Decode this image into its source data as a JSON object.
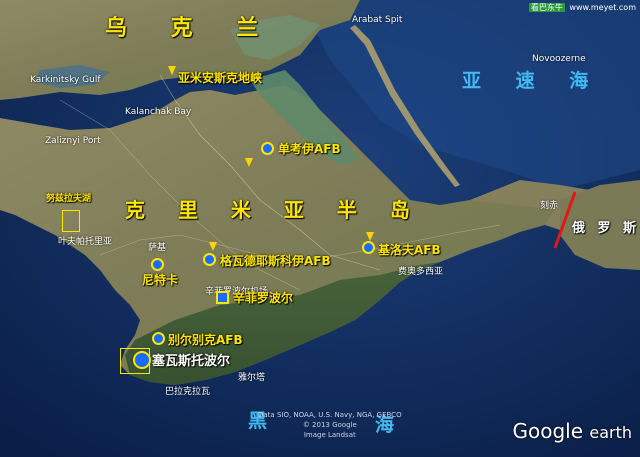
{
  "watermark": {
    "badge": "看巴东牛",
    "site": "www.meyet.com"
  },
  "regions": {
    "ukraine": "乌 克 兰",
    "crimea": "克 里 米 亚 半 岛",
    "azov_sea": "亚 速 海",
    "black_sea_left": "黑",
    "black_sea_right": "海",
    "russia": "俄 罗 斯"
  },
  "cities": {
    "perekop": "亚米安斯克地峡",
    "dzhankoy": "单考伊AFB",
    "kirovske": "基洛夫AFB",
    "saky": "尼特卡",
    "gvardeyskoye": "格瓦德耶斯科伊AFB",
    "simferopol": "辛菲罗波尔",
    "belbek": "别尔别克AFB",
    "sevastopol": "塞瓦斯托波尔",
    "donuzlav": "努兹拉夫湖"
  },
  "small_labels": {
    "yevpatoriya": "叶夫帕托里亚",
    "feodosiya": "费奥多西亚",
    "yalta": "雅尔塔",
    "balaklava": "巴拉克拉瓦",
    "karkinitsky": "Karkinitsky Gulf",
    "kalanchak": "Kalanchak Bay",
    "zaliznyi": "Zaliznyi Port",
    "arabat": "Arabat Spit",
    "kerch": "刻赤",
    "novoozerne": "Novoozerne",
    "saki_airbase": "萨基",
    "simferopol_airport": "辛菲罗波尔机场"
  },
  "colors": {
    "label_yellow": "#ffe600",
    "sea_label": "#41b8f0",
    "marker_blue": "#1a6cff",
    "border_red": "#e01818"
  },
  "credits": {
    "line1": "Data SIO, NOAA, U.S. Navy, NGA, GEBCO",
    "line2": "© 2013 Google",
    "line3": "Image Landsat"
  },
  "logo": {
    "brand": "Google",
    "product": "earth"
  }
}
